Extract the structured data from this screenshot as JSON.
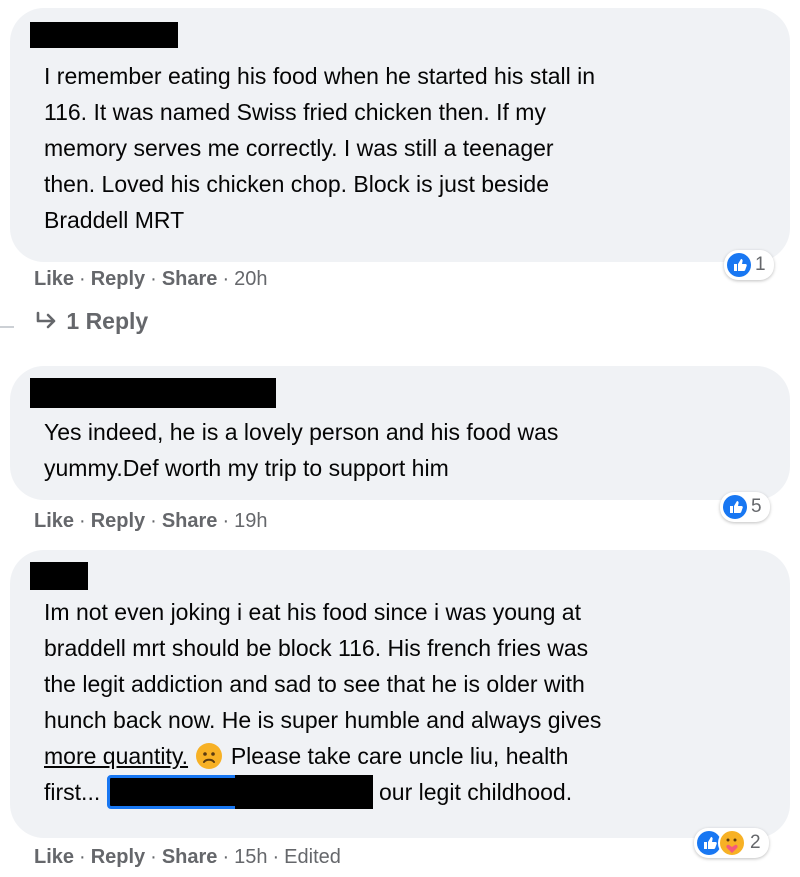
{
  "comments": [
    {
      "text_lines": [
        "I remember eating his food when he started his stall in",
        "116. It was named Swiss fried chicken then. If my",
        "memory serves me correctly. I was still a teenager",
        "then. Loved his chicken chop. Block is just beside",
        "Braddell MRT"
      ],
      "actions": {
        "like": "Like",
        "reply": "Reply",
        "share": "Share",
        "time": "20h"
      },
      "reaction_count": "1",
      "reaction_icons": [
        "like-icon"
      ]
    },
    {
      "text_lines": [
        "Yes indeed, he is a lovely person and his food was",
        "yummy.Def worth my trip to support him"
      ],
      "actions": {
        "like": "Like",
        "reply": "Reply",
        "share": "Share",
        "time": "19h"
      },
      "reaction_count": "5",
      "reaction_icons": [
        "like-icon"
      ]
    },
    {
      "text_lines": [
        "Im not even joking i eat his food since i was young at",
        "braddell mrt should be block 116. His french fries was",
        "the legit addiction and sad to see that he is older with",
        "hunch back now. He is super humble and always gives"
      ],
      "line5_before": "more quantity.",
      "line5_after": "Please take care uncle liu, health",
      "line6_before": "first...",
      "line6_after": "our legit childhood.",
      "actions": {
        "like": "Like",
        "reply": "Reply",
        "share": "Share",
        "time": "15h",
        "edited": "Edited"
      },
      "reaction_count": "2",
      "reaction_icons": [
        "like-icon",
        "care-icon"
      ]
    }
  ],
  "reply_toggle": {
    "label": "1 Reply",
    "icon": "reply-arrow-icon"
  },
  "separator": "·",
  "colors": {
    "bubble": "#f0f2f5",
    "meta": "#65676b",
    "like_blue": "#1877f2",
    "care_yellow": "#f7b125"
  }
}
